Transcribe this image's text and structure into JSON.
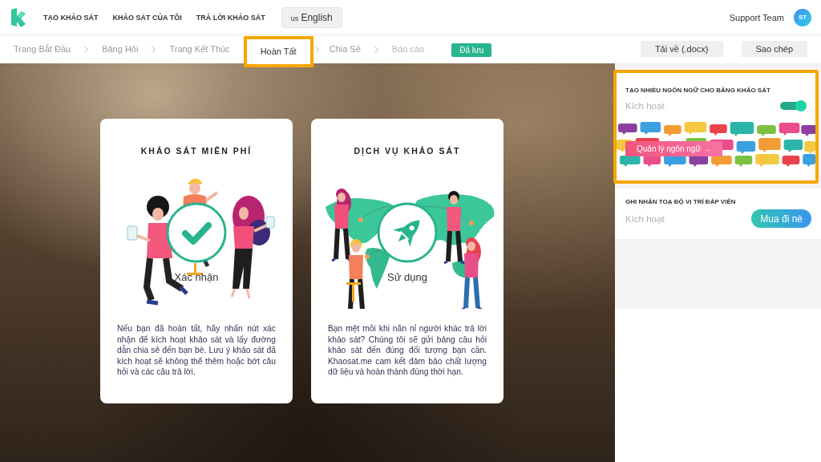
{
  "header": {
    "nav": [
      {
        "label": "TẠO KHẢO SÁT"
      },
      {
        "label": "KHẢO SÁT CỦA TÔI"
      },
      {
        "label": "TRẢ LỜI KHẢO SÁT"
      }
    ],
    "language": {
      "flag": "us",
      "label": "English"
    },
    "user": {
      "name": "Support Team",
      "initials": "ST"
    }
  },
  "steps": [
    {
      "label": "Trang Bắt Đầu",
      "selected": false,
      "disabled": false
    },
    {
      "label": "Bảng Hỏi",
      "selected": false,
      "disabled": false
    },
    {
      "label": "Trang Kết Thúc",
      "selected": false,
      "disabled": false
    },
    {
      "label": "Hoàn Tất",
      "selected": true,
      "disabled": false
    },
    {
      "label": "Chia Sẻ",
      "selected": false,
      "disabled": false
    },
    {
      "label": "Báo cáo",
      "selected": false,
      "disabled": true
    }
  ],
  "saved_badge": "Đã lưu",
  "actions": [
    {
      "label": "Tải về (.docx)"
    },
    {
      "label": "Sao chép"
    }
  ],
  "cards": [
    {
      "kind": "confirm",
      "title": "KHẢO SÁT MIỄN PHÍ",
      "action": "Xác nhận",
      "text": "Nếu bạn đã hoàn tất, hãy nhấn nút xác nhận để kích hoạt khảo sát và lấy đường dẫn chia sẻ đến bạn bè. Lưu ý khảo sát đã kích hoạt sẽ không thể thêm hoặc bớt câu hỏi và các câu trả lời."
    },
    {
      "kind": "service",
      "title": "DỊCH VỤ KHẢO SÁT",
      "action": "Sử dụng",
      "text": "Bạn mệt mỏi khi năn nỉ người khác trả lời khảo sát? Chúng tôi sẽ gửi bảng câu hỏi khảo sát đến đúng đối tượng bạn cần. Khaosat.me cam kết đảm bảo chất lượng dữ liệu và hoàn thành đúng thời hạn."
    }
  ],
  "features": [
    {
      "kind": "toggle",
      "title": "TẠO NHIỀU NGÔN NGỮ CHO BẢNG KHẢO SÁT",
      "status": "Kích hoạt",
      "on": true,
      "highlighted": true,
      "button": "Quản lý ngôn ngữ →"
    },
    {
      "kind": "purchase",
      "title": "GHI NHẬN TOẠ ĐỘ VỊ TRÍ ĐÁP VIÊN",
      "status": "Kích hoạt",
      "highlighted": false,
      "button": "Mua đi nè"
    }
  ]
}
